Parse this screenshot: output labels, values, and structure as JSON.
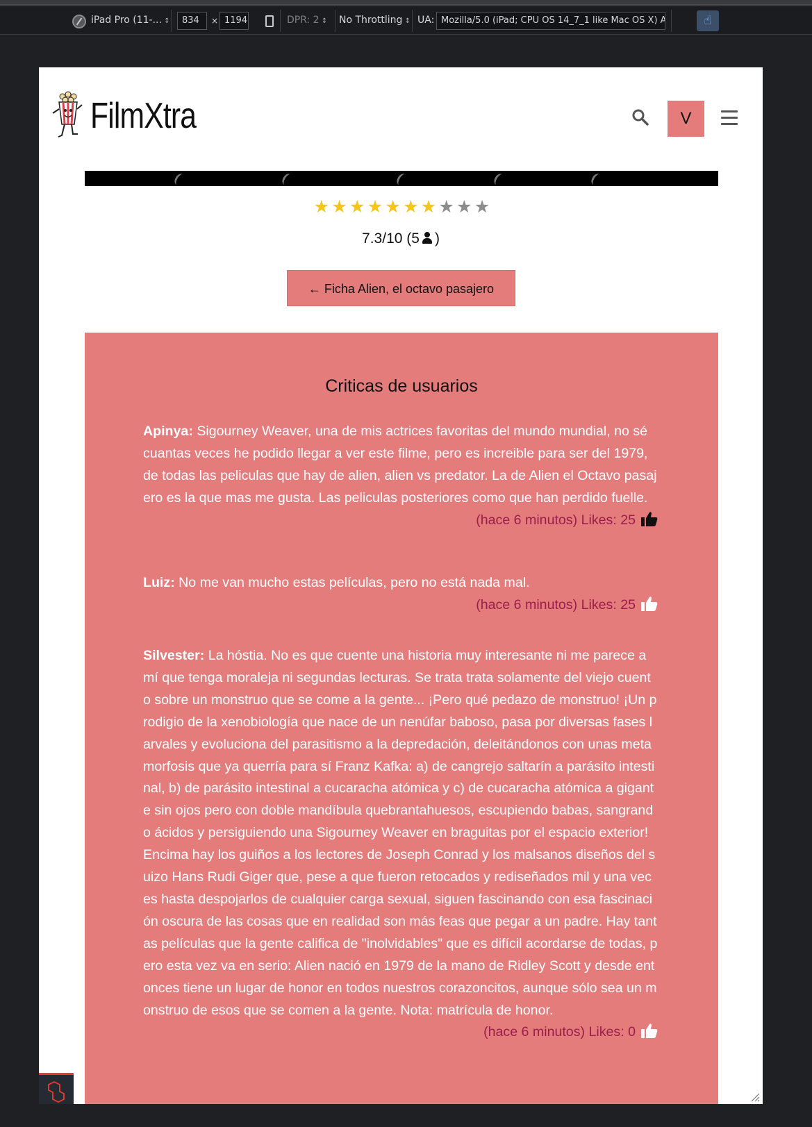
{
  "devtools": {
    "device": "iPad Pro (11-...",
    "width": "834",
    "times": "×",
    "height": "1194",
    "dpr": "DPR: 2",
    "throttling": "No Throttling",
    "ua_label": "UA:",
    "ua_value": "Mozilla/5.0 (iPad; CPU OS 14_7_1 like Mac OS X) A"
  },
  "header": {
    "logo_text": "FilmXtra",
    "user_initial": "V"
  },
  "rating": {
    "stars_filled": 7,
    "stars_total": 10,
    "score_text": "7.3/10 (5",
    "close_paren": ")"
  },
  "back_button": "← Ficha Alien, el octavo pasajero",
  "reviews": {
    "title": "Criticas de usuarios",
    "items": [
      {
        "author": "Apinya:",
        "text": "Sigourney Weaver, una de mis actrices favoritas del mundo mundial, no sé cuantas veces he podido llegar a ver este filme, pero es increible para ser del 1979, de todas las peliculas que hay de alien, alien vs predator. La de Alien el Octavo pasajero es la que mas me gusta. Las peliculas posteriores como que han perdido fuelle.",
        "meta": "(hace 6 minutos) Likes: 25",
        "liked": true
      },
      {
        "author": "Luiz:",
        "text": "No me van mucho estas películas, pero no está nada mal.",
        "meta": "(hace 6 minutos) Likes: 25",
        "liked": false
      },
      {
        "author": "Silvester:",
        "text": "La hóstia. No es que cuente una historia muy interesante ni me parece a mí que tenga moraleja ni segundas lecturas. Se trata trata solamente del viejo cuento sobre un monstruo que se come a la gente... ¡Pero qué pedazo de monstruo! ¡Un prodigio de la xenobiología que nace de un nenúfar baboso, pasa por diversas fases larvales y evoluciona del parasitismo a la depredación, deleitándonos con unas metamorfosis que ya querría para sí Franz Kafka: a) de cangrejo saltarín a parásito intestinal, b) de parásito intestinal a cucaracha atómica y c) de cucaracha atómica a gigante sin ojos pero con doble mandíbula quebrantahuesos, escupiendo babas, sangrando ácidos y persiguiendo una Sigourney Weaver en braguitas por el espacio exterior! Encima hay los guiños a los lectores de Joseph Conrad y los malsanos diseños del suizo Hans Rudi Giger que, pese a que fueron retocados y rediseñados mil y una veces hasta despojarlos de cualquier carga sexual, siguen fascinando con esa fascinación oscura de las cosas que en realidad son más feas que pegar a un padre. Hay tantas películas que la gente califica de \"inolvidables\" que es difícil acordarse de todas, pero esta vez va en serio: Alien nació en 1979 de la mano de Ridley Scott y desde entonces tiene un lugar de honor en todos nuestros corazoncitos, aunque sólo sea un monstruo de esos que se comen a la gente. Nota: matrícula de honor.",
        "meta": "(hace 6 minutos) Likes: 0",
        "liked": false
      }
    ]
  },
  "colors": {
    "accent": "#e47c7c",
    "meta_text": "#9b1d4a",
    "star_on": "#f5c518",
    "star_off": "#8c8c8c"
  },
  "icons": [
    "device-icon",
    "rotate-icon",
    "touch-icon",
    "popcorn-logo-icon",
    "search-icon",
    "menu-icon",
    "user-icon",
    "thumbs-up-icon",
    "laravel-icon",
    "resize-grip-icon"
  ]
}
